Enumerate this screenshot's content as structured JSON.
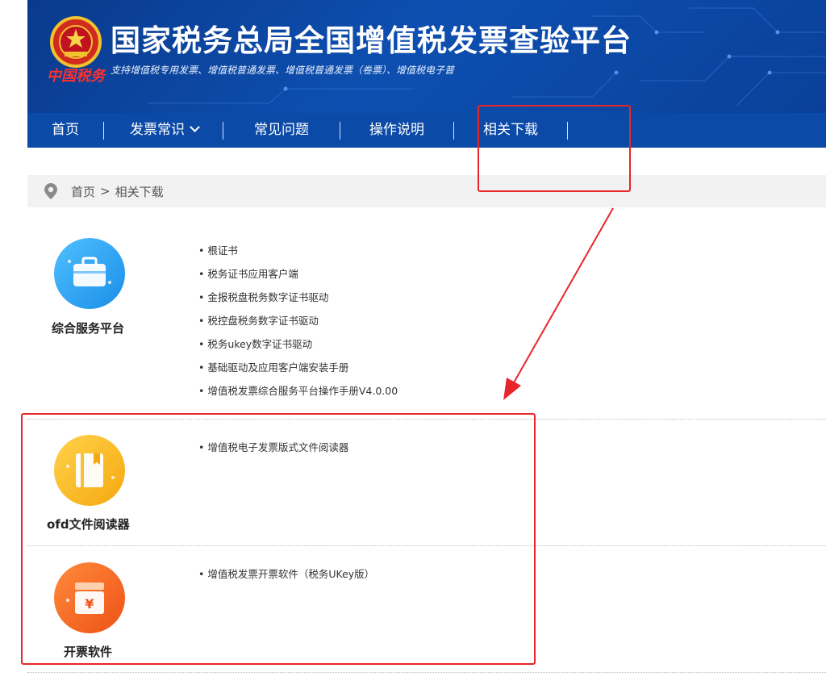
{
  "header": {
    "title": "国家税务总局全国增值税发票查验平台",
    "subtitle": "支持增值税专用发票、增值税普通发票、增值税普通发票（卷票）、增值税电子普",
    "signature": "中国税务"
  },
  "nav": {
    "items": [
      {
        "label": "首页"
      },
      {
        "label": "发票常识"
      },
      {
        "label": "常见问题"
      },
      {
        "label": "操作说明"
      },
      {
        "label": "相关下载"
      }
    ]
  },
  "breadcrumb": {
    "home": "首页",
    "separator": ">",
    "current": "相关下载"
  },
  "sections": [
    {
      "title": "综合服务平台",
      "icon": "briefcase-icon",
      "color": "#2aa3f0",
      "links": [
        "根证书",
        "税务证书应用客户端",
        "金报税盘税务数字证书驱动",
        "税控盘税务数字证书驱动",
        "税务ukey数字证书驱动",
        "基础驱动及应用客户端安装手册",
        "增值税发票综合服务平台操作手册V4.0.00"
      ]
    },
    {
      "title": "ofd文件阅读器",
      "icon": "book-icon",
      "color": "#f5b51c",
      "links": [
        "增值税电子发票版式文件阅读器"
      ]
    },
    {
      "title": "开票软件",
      "icon": "invoice-box-icon",
      "color": "#f26a22",
      "links": [
        "增值税发票开票软件（税务UKey版）"
      ]
    }
  ],
  "annotation_color": "#e8262a"
}
